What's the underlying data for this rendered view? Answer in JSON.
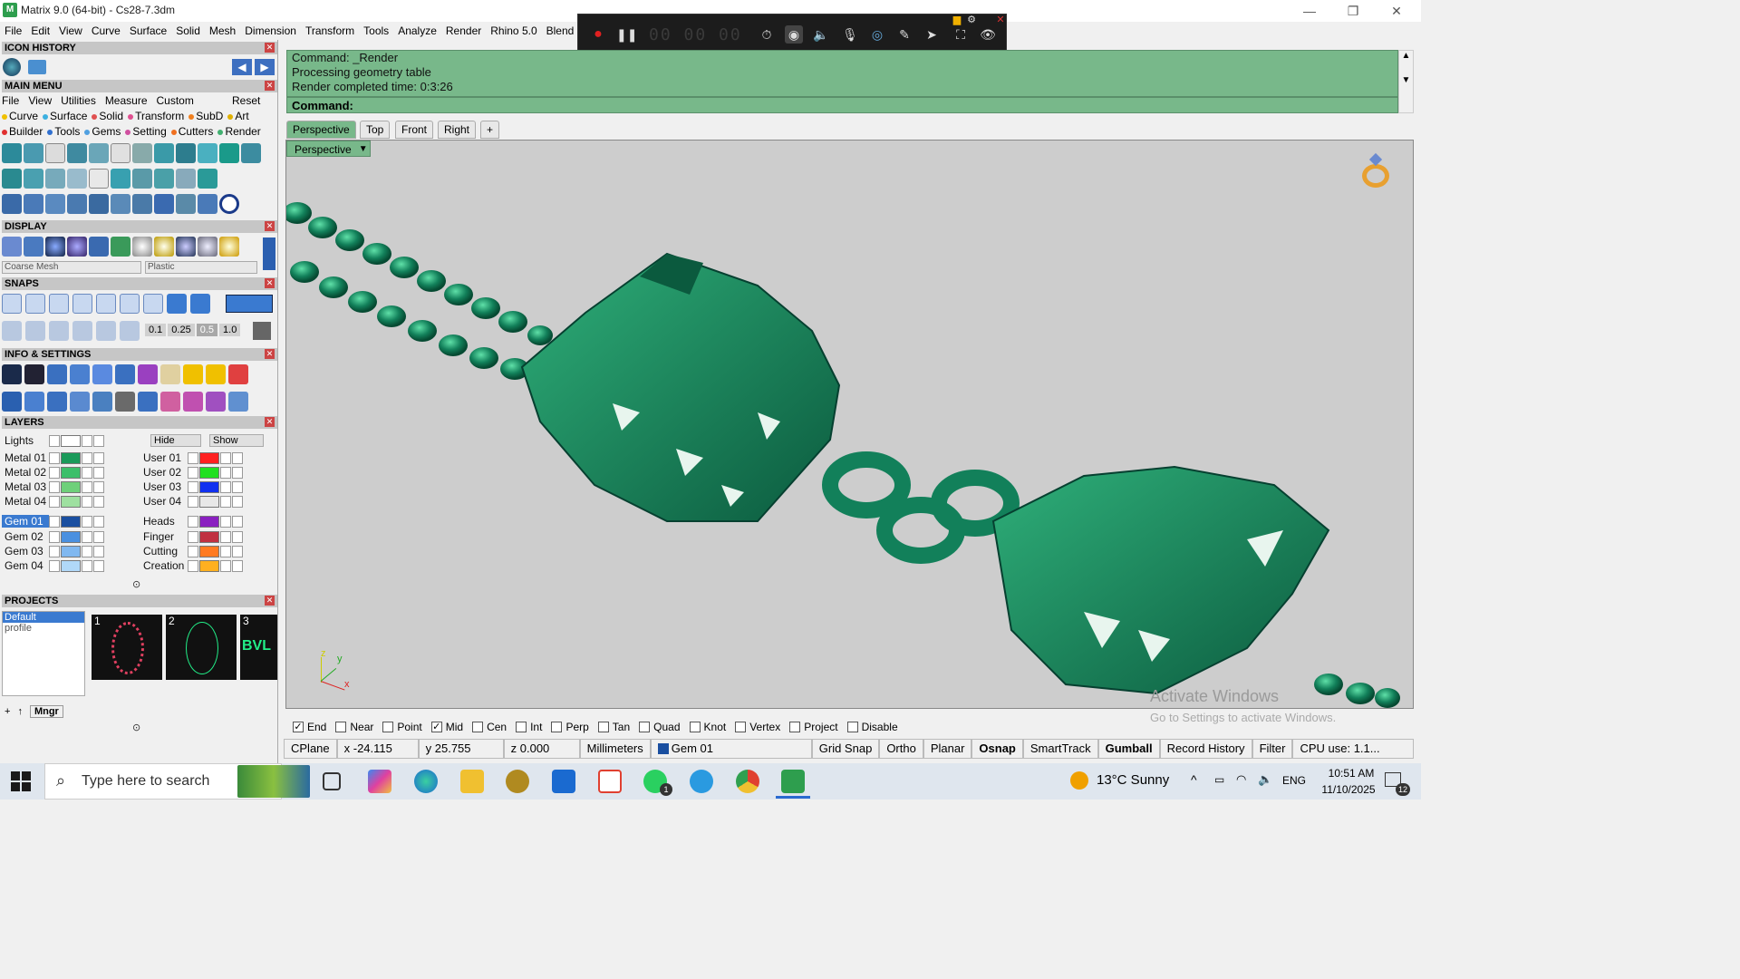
{
  "window": {
    "title": "Matrix 9.0 (64-bit) - Cs28-7.3dm",
    "minimize": "—",
    "restore": "❐",
    "close": "✕"
  },
  "menubar": [
    "File",
    "Edit",
    "View",
    "Curve",
    "Surface",
    "Solid",
    "Mesh",
    "Dimension",
    "Transform",
    "Tools",
    "Analyze",
    "Render",
    "Rhino 5.0",
    "Blend",
    "Cl"
  ],
  "recorder": {
    "timer": "00 00 00"
  },
  "panels": {
    "icon_history": "ICON HISTORY",
    "main_menu": "MAIN MENU",
    "display": "DISPLAY",
    "snaps": "SNAPS",
    "info_settings": "INFO & SETTINGS",
    "layers": "LAYERS",
    "projects": "PROJECTS"
  },
  "main_menu": {
    "top_row": [
      "File",
      "View",
      "Utilities",
      "Measure",
      "Custom"
    ],
    "reset": "Reset",
    "row2": [
      {
        "label": "Curve",
        "color": "#f0c000"
      },
      {
        "label": "Surface",
        "color": "#3cb0e0"
      },
      {
        "label": "Solid",
        "color": "#e05050"
      },
      {
        "label": "Transform",
        "color": "#e05090"
      },
      {
        "label": "SubD",
        "color": "#f08020"
      },
      {
        "label": "Art",
        "color": "#e0b000"
      }
    ],
    "row3": [
      {
        "label": "Builder",
        "color": "#e03030"
      },
      {
        "label": "Tools",
        "color": "#3070d0"
      },
      {
        "label": "Gems",
        "color": "#50a0e0"
      },
      {
        "label": "Setting",
        "color": "#d050a0"
      },
      {
        "label": "Cutters",
        "color": "#f07020"
      },
      {
        "label": "Render",
        "color": "#40b070"
      }
    ]
  },
  "display": {
    "mesh_select": "Coarse Mesh",
    "material_select": "Plastic"
  },
  "snaps": {
    "values": [
      "0.1",
      "0.25",
      "0.5",
      "1.0"
    ]
  },
  "layers": {
    "lights": "Lights",
    "hide": "Hide",
    "show": "Show",
    "left": [
      {
        "name": "Metal 01",
        "color": "#1a9a5a"
      },
      {
        "name": "Metal 02",
        "color": "#3cbf6a"
      },
      {
        "name": "Metal 03",
        "color": "#6ed07a"
      },
      {
        "name": "Metal 04",
        "color": "#9ee0a0"
      },
      {
        "name": "Gem 01",
        "color": "#1a4fa0"
      },
      {
        "name": "Gem 02",
        "color": "#4a90e0"
      },
      {
        "name": "Gem 03",
        "color": "#80b8f0"
      },
      {
        "name": "Gem 04",
        "color": "#b0d8f8"
      }
    ],
    "right": [
      {
        "name": "User 01",
        "color": "#ff2020"
      },
      {
        "name": "User 02",
        "color": "#20e020"
      },
      {
        "name": "User 03",
        "color": "#1030f0"
      },
      {
        "name": "User 04",
        "color": "#e8e8e8"
      },
      {
        "name": "Heads",
        "color": "#8a20c0"
      },
      {
        "name": "Finger",
        "color": "#c03040"
      },
      {
        "name": "Cutting",
        "color": "#ff7a20"
      },
      {
        "name": "Creation",
        "color": "#ffb020"
      }
    ]
  },
  "projects": {
    "profile_line1": "Default",
    "profile_line2": "profile",
    "thumbs": [
      "1",
      "2",
      "3"
    ],
    "mngr": "Mngr",
    "thumb3_text": "BVL"
  },
  "command": {
    "history": [
      "Command: _Render",
      "Processing geometry table",
      "Render completed time: 0:3:26"
    ],
    "prompt": "Command:"
  },
  "viewport_tabs": [
    "Perspective",
    "Top",
    "Front",
    "Right",
    "+"
  ],
  "viewport": {
    "label": "Perspective",
    "axis_z": "z",
    "axis_y": "y",
    "axis_x": "x",
    "watermark_title": "Activate Windows",
    "watermark_sub": "Go to Settings to activate Windows."
  },
  "osnap": [
    {
      "label": "End",
      "checked": true
    },
    {
      "label": "Near",
      "checked": false
    },
    {
      "label": "Point",
      "checked": false
    },
    {
      "label": "Mid",
      "checked": true
    },
    {
      "label": "Cen",
      "checked": false
    },
    {
      "label": "Int",
      "checked": false
    },
    {
      "label": "Perp",
      "checked": false
    },
    {
      "label": "Tan",
      "checked": false
    },
    {
      "label": "Quad",
      "checked": false
    },
    {
      "label": "Knot",
      "checked": false
    },
    {
      "label": "Vertex",
      "checked": false
    },
    {
      "label": "Project",
      "checked": false
    },
    {
      "label": "Disable",
      "checked": false
    }
  ],
  "statusbar": {
    "cplane": "CPlane",
    "x": "x -24.115",
    "y": "y 25.755",
    "z": "z 0.000",
    "units": "Millimeters",
    "layer": "Gem 01",
    "grid_snap": "Grid Snap",
    "ortho": "Ortho",
    "planar": "Planar",
    "osnap": "Osnap",
    "smarttrack": "SmartTrack",
    "gumball": "Gumball",
    "record_history": "Record History",
    "filter": "Filter",
    "cpu": "CPU use: 1.1..."
  },
  "taskbar": {
    "search_placeholder": "Type here to search",
    "weather": "13°C  Sunny",
    "lang": "ENG",
    "time": "10:51 AM",
    "date": "11/10/2025",
    "notif_count": "12",
    "whatsapp_badge": "1"
  },
  "colors": {
    "command_bg": "#78b88a",
    "model_green": "#12805a",
    "viewport_bg": "#cdcdcd"
  }
}
